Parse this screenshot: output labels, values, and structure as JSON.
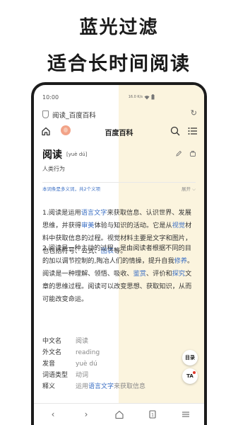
{
  "promo": {
    "line1": "蓝光过滤",
    "line2": "适合长时间阅读"
  },
  "status_bar": {
    "time": "10:00",
    "network_rate": "16.0 K/s"
  },
  "browser": {
    "page_title": "阅读_百度百科",
    "reload_icon": "reload-icon"
  },
  "site_nav": {
    "site_name": "百度百科",
    "icons": [
      "home-icon",
      "baike-logo",
      "search-icon",
      "menu-icon"
    ]
  },
  "entry": {
    "headword": "阅读",
    "pinyin": "[yuè dú]",
    "category": "人类行为",
    "senses_note": "本词条是多义词，共2个义项",
    "expand_label": "展开"
  },
  "paragraph1": {
    "t1": "1.阅读是运用",
    "link1": "语言文字",
    "t2": "来获取信息、认识世界、发展思维，并获得",
    "link2": "审美",
    "t3": "体验与知识的活动。它是从",
    "link3": "视觉",
    "t4": "材料中获取信息的过程。视觉材料主要是文字和图片，也包括符号、公式、",
    "link4": "图表",
    "t5": "等。"
  },
  "paragraph2": {
    "t1": "2.阅读是一种主动的过程，是由阅读者根据不同的目的加以调节控制的,陶冶人们的情操，提升自我",
    "link1": "修养",
    "t2": "。阅读是一种理解、领悟、吸收、",
    "link2": "鉴赏",
    "t3": "、评价和",
    "link3": "探究",
    "t4": "文章的思维过程。阅读可以改变思想、获取知识，从而可能改变命运。"
  },
  "basic_info": [
    {
      "key": "中文名",
      "value": "阅读"
    },
    {
      "key": "外文名",
      "value": "reading"
    },
    {
      "key": "发音",
      "value": "yuè dú"
    },
    {
      "key": "词语类型",
      "value": "动词"
    }
  ],
  "definition_row": {
    "key": "释义",
    "v1": "运用",
    "link": "语言文字",
    "v2": "来获取信息"
  },
  "floating": {
    "toc_label": "目录",
    "font_label": "TA"
  },
  "bottom_nav": [
    "back-icon",
    "forward-icon",
    "home-icon",
    "tabs-icon",
    "menu-icon"
  ]
}
